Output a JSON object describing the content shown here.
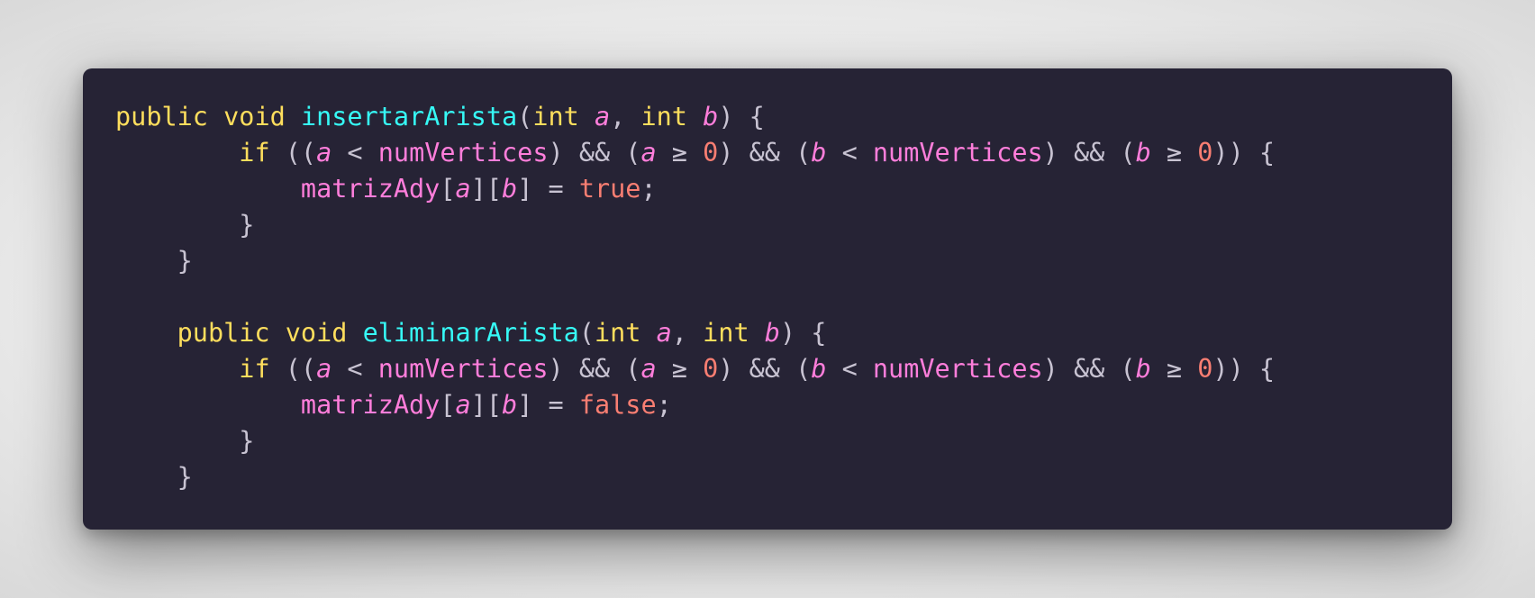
{
  "colors": {
    "background": "#ececec",
    "editor_bg": "#262335",
    "keyword": "#fede5d",
    "function": "#36f9f6",
    "variable": "#ff7edb",
    "number": "#f97e72",
    "text": "#c8c3d2"
  },
  "code": {
    "lines": [
      {
        "indent": "",
        "tokens": [
          {
            "t": "public",
            "c": "kw"
          },
          {
            "t": " ",
            "c": "op"
          },
          {
            "t": "void",
            "c": "kw"
          },
          {
            "t": " ",
            "c": "op"
          },
          {
            "t": "insertarArista",
            "c": "fn"
          },
          {
            "t": "(",
            "c": "op"
          },
          {
            "t": "int",
            "c": "kw"
          },
          {
            "t": " ",
            "c": "op"
          },
          {
            "t": "a",
            "c": "var"
          },
          {
            "t": ", ",
            "c": "op"
          },
          {
            "t": "int",
            "c": "kw"
          },
          {
            "t": " ",
            "c": "op"
          },
          {
            "t": "b",
            "c": "var"
          },
          {
            "t": ") {",
            "c": "op"
          }
        ]
      },
      {
        "indent": "        ",
        "tokens": [
          {
            "t": "if",
            "c": "kw"
          },
          {
            "t": " ((",
            "c": "op"
          },
          {
            "t": "a",
            "c": "var"
          },
          {
            "t": " < ",
            "c": "op"
          },
          {
            "t": "numVertices",
            "c": "prop"
          },
          {
            "t": ") && (",
            "c": "op"
          },
          {
            "t": "a",
            "c": "var"
          },
          {
            "t": " ≥ ",
            "c": "op"
          },
          {
            "t": "0",
            "c": "num"
          },
          {
            "t": ") && (",
            "c": "op"
          },
          {
            "t": "b",
            "c": "var"
          },
          {
            "t": " < ",
            "c": "op"
          },
          {
            "t": "numVertices",
            "c": "prop"
          },
          {
            "t": ") && (",
            "c": "op"
          },
          {
            "t": "b",
            "c": "var"
          },
          {
            "t": " ≥ ",
            "c": "op"
          },
          {
            "t": "0",
            "c": "num"
          },
          {
            "t": ")) {",
            "c": "op"
          }
        ]
      },
      {
        "indent": "            ",
        "tokens": [
          {
            "t": "matrizAdy",
            "c": "prop"
          },
          {
            "t": "[",
            "c": "op"
          },
          {
            "t": "a",
            "c": "var"
          },
          {
            "t": "][",
            "c": "op"
          },
          {
            "t": "b",
            "c": "var"
          },
          {
            "t": "] = ",
            "c": "op"
          },
          {
            "t": "true",
            "c": "lit"
          },
          {
            "t": ";",
            "c": "op"
          }
        ]
      },
      {
        "indent": "        ",
        "tokens": [
          {
            "t": "}",
            "c": "op"
          }
        ]
      },
      {
        "indent": "    ",
        "tokens": [
          {
            "t": "}",
            "c": "op"
          }
        ]
      },
      {
        "indent": "",
        "tokens": []
      },
      {
        "indent": "    ",
        "tokens": [
          {
            "t": "public",
            "c": "kw"
          },
          {
            "t": " ",
            "c": "op"
          },
          {
            "t": "void",
            "c": "kw"
          },
          {
            "t": " ",
            "c": "op"
          },
          {
            "t": "eliminarArista",
            "c": "fn"
          },
          {
            "t": "(",
            "c": "op"
          },
          {
            "t": "int",
            "c": "kw"
          },
          {
            "t": " ",
            "c": "op"
          },
          {
            "t": "a",
            "c": "var"
          },
          {
            "t": ", ",
            "c": "op"
          },
          {
            "t": "int",
            "c": "kw"
          },
          {
            "t": " ",
            "c": "op"
          },
          {
            "t": "b",
            "c": "var"
          },
          {
            "t": ") {",
            "c": "op"
          }
        ]
      },
      {
        "indent": "        ",
        "tokens": [
          {
            "t": "if",
            "c": "kw"
          },
          {
            "t": " ((",
            "c": "op"
          },
          {
            "t": "a",
            "c": "var"
          },
          {
            "t": " < ",
            "c": "op"
          },
          {
            "t": "numVertices",
            "c": "prop"
          },
          {
            "t": ") && (",
            "c": "op"
          },
          {
            "t": "a",
            "c": "var"
          },
          {
            "t": " ≥ ",
            "c": "op"
          },
          {
            "t": "0",
            "c": "num"
          },
          {
            "t": ") && (",
            "c": "op"
          },
          {
            "t": "b",
            "c": "var"
          },
          {
            "t": " < ",
            "c": "op"
          },
          {
            "t": "numVertices",
            "c": "prop"
          },
          {
            "t": ") && (",
            "c": "op"
          },
          {
            "t": "b",
            "c": "var"
          },
          {
            "t": " ≥ ",
            "c": "op"
          },
          {
            "t": "0",
            "c": "num"
          },
          {
            "t": ")) {",
            "c": "op"
          }
        ]
      },
      {
        "indent": "            ",
        "tokens": [
          {
            "t": "matrizAdy",
            "c": "prop"
          },
          {
            "t": "[",
            "c": "op"
          },
          {
            "t": "a",
            "c": "var"
          },
          {
            "t": "][",
            "c": "op"
          },
          {
            "t": "b",
            "c": "var"
          },
          {
            "t": "] = ",
            "c": "op"
          },
          {
            "t": "false",
            "c": "lit"
          },
          {
            "t": ";",
            "c": "op"
          }
        ]
      },
      {
        "indent": "        ",
        "tokens": [
          {
            "t": "}",
            "c": "op"
          }
        ]
      },
      {
        "indent": "    ",
        "tokens": [
          {
            "t": "}",
            "c": "op"
          }
        ]
      }
    ]
  }
}
